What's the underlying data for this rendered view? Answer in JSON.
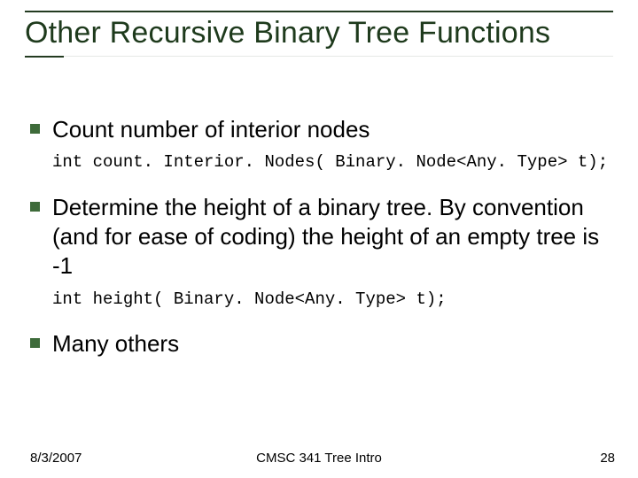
{
  "title": "Other Recursive Binary Tree Functions",
  "bullets": [
    {
      "text": "Count number of interior nodes",
      "code": "int count. Interior. Nodes( Binary. Node<Any. Type> t);"
    },
    {
      "text": "Determine the height of a binary tree.  By convention (and for ease of coding) the height of an empty tree is -1",
      "code": "int height( Binary. Node<Any. Type> t);"
    },
    {
      "text": "Many others",
      "code": null
    }
  ],
  "footer": {
    "date": "8/3/2007",
    "course": "CMSC 341 Tree Intro",
    "page": "28"
  }
}
